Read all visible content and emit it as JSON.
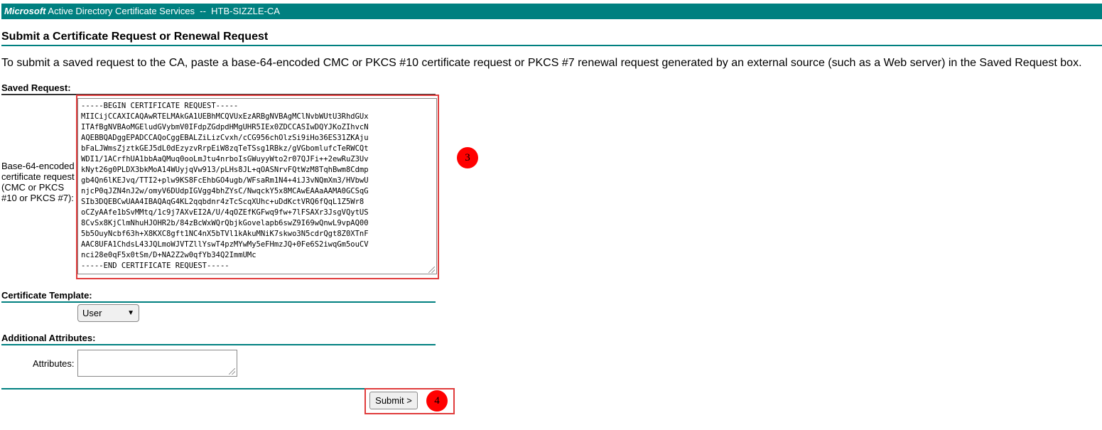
{
  "header": {
    "brand": "Microsoft",
    "title": "Active Directory Certificate Services",
    "separator": "--",
    "ca_name": "HTB-SIZZLE-CA",
    "bg_color": "#008080"
  },
  "page_title": "Submit a Certificate Request or Renewal Request",
  "intro": "To submit a saved request to the CA, paste a base-64-encoded CMC or PKCS #10 certificate request or PKCS #7 renewal request generated by an external source (such as a Web server) in the Saved Request box.",
  "saved_request": {
    "section_label": "Saved Request:",
    "field_label": "Base-64-encoded certificate request (CMC or PKCS #10 or PKCS #7):",
    "value": "-----BEGIN CERTIFICATE REQUEST-----\nMIICijCCAXICAQAwRTELMAkGA1UEBhMCQVUxEzARBgNVBAgMClNvbWUtU3RhdGUx\nITAfBgNVBAoMGEludGVybmV0IFdpZGdpdHMgUHR5IEx0ZDCCASIwDQYJKoZIhvcN\nAQEBBQADggEPADCCAQoCggEBALZiLizCvxh/cCG956chOlzSi9iHo36ES31ZKAju\nbFaLJWmsZjztkGEJ5dL0dEzyzvRrpEiW8zqTeTSsg1RBkz/gVGbomlufcTeRWCQt\nWDI1/1ACrfhUA1bbAaQMuq0ooLmJtu4nrboIsGWuyyWto2r07QJFi++2ewRuZ3Uv\nkNyt26g0PLDX3bkMoA14WUyjqVw913/pLHs8JL+qOASNrvFQtWzM8TqhBwm8Cdmp\ngb4Qn6lKEJvq/TTI2+plw9KS8FcEhbGO4ugb/WFsaRm1N4+4iJ3vNQmXm3/HVbwU\nnjcP0qJZN4nJ2w/omyV6DUdpIGVgg4bhZYsC/NwqckY5x8MCAwEAAaAAMA0GCSqG\nSIb3DQEBCwUAA4IBAQAqG4KL2qqbdnr4zTcScqXUhc+uDdKctVRQ6fQqL1Z5Wr8\noCZyAAfe1bSvMMtq/1c9j7AXvEI2A/U/4qOZEfKGFwq9fw+7lFSAXr3JsgVQytUS\n8CvSx8KjClmNhuHJOHR2b/84zBcWxWQrQbjkGovelapb6swZ9I69wQnwL9vpAQ00\n5b5OuyNcbf63h+X8KXC8gft1NC4nX5bTVl1kAkuMNiK7skwo3N5cdrQgt8Z0XTnF\nAAC8UFA1ChdsL43JQLmoWJVTZllYswT4pzMYwMy5eFHmzJQ+0Fe6S2iwqGm5ouCV\nnci28e0qF5x0tSm/D+NA2Z2w0qfYb34Q2ImmUMc\n-----END CERTIFICATE REQUEST-----"
  },
  "template": {
    "section_label": "Certificate Template:",
    "selected": "User"
  },
  "attributes": {
    "section_label": "Additional Attributes:",
    "field_label": "Attributes:",
    "value": ""
  },
  "submit_label": "Submit >",
  "annotations": {
    "step3": "3",
    "step4": "4",
    "marker_color": "#ff0000",
    "box_color": "#e03c3c"
  }
}
